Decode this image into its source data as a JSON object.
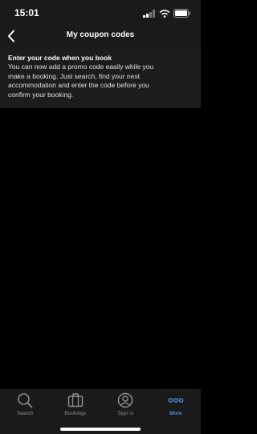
{
  "status_bar": {
    "time": "15:01"
  },
  "header": {
    "title": "My coupon codes"
  },
  "promo": {
    "heading": "Enter your code when you book",
    "body_lines": [
      "You can now add a promo code easily while you",
      "make a booking. Just search, find your next",
      "accommodation and enter the code before you",
      "confirm your booking."
    ]
  },
  "tabs": [
    {
      "label": "Search",
      "icon": "search-icon",
      "active": false
    },
    {
      "label": "Bookings",
      "icon": "suitcase-icon",
      "active": false
    },
    {
      "label": "Sign in",
      "icon": "profile-icon",
      "active": false
    },
    {
      "label": "More",
      "icon": "more-dots-icon",
      "active": true
    }
  ],
  "colors": {
    "background": "#000000",
    "bar_background": "#1a1a1a",
    "section_background": "#1c1c1e",
    "inactive_tab": "#8e8e93",
    "active_tab": "#4a90e2"
  }
}
